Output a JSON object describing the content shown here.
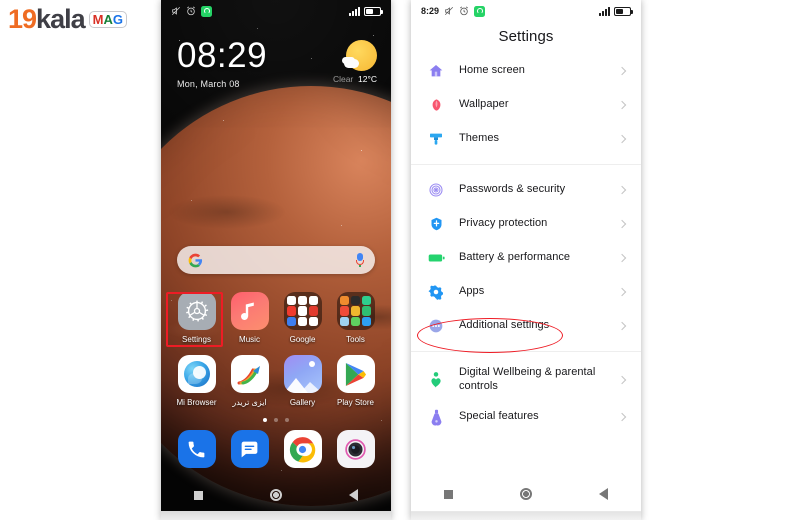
{
  "watermark": {
    "brand_prefix": "19",
    "brand_main": "kala",
    "badge": "MAG",
    "badge_letters": [
      "M",
      "A",
      "G"
    ],
    "color_orange": "#ef6c23",
    "color_dark": "#3f3f46"
  },
  "left_phone": {
    "status_bar": {
      "icons": [
        "mute-icon",
        "alarm-icon",
        "whatsapp-icon",
        "signal-icon",
        "battery-icon"
      ]
    },
    "clock_widget": {
      "time": "08:29",
      "date": "Mon, March 08"
    },
    "weather_widget": {
      "condition": "Clear",
      "temperature": "12°C",
      "icon": "sun-behind-cloud-icon"
    },
    "search_bar": {
      "logo": "G",
      "google_logo_letters": [
        "G"
      ],
      "mic": "microphone-icon",
      "placeholder": ""
    },
    "apps_row1": [
      {
        "label": "Settings",
        "icon": "gear-icon",
        "highlighted": true
      },
      {
        "label": "Music",
        "icon": "music-note-icon",
        "highlighted": false
      },
      {
        "label": "Google",
        "icon": "folder-icon",
        "highlighted": false
      },
      {
        "label": "Tools",
        "icon": "folder-icon",
        "highlighted": false
      }
    ],
    "apps_row2": [
      {
        "label": "Mi Browser",
        "icon": "mi-browser-icon"
      },
      {
        "label": "ایزی تریدر",
        "icon": "easy-trader-icon"
      },
      {
        "label": "Gallery",
        "icon": "gallery-icon"
      },
      {
        "label": "Play Store",
        "icon": "play-store-icon"
      }
    ],
    "dock": [
      {
        "label": "Phone",
        "icon": "phone-icon"
      },
      {
        "label": "Messages",
        "icon": "message-icon"
      },
      {
        "label": "Chrome",
        "icon": "chrome-icon"
      },
      {
        "label": "Camera",
        "icon": "camera-icon"
      }
    ],
    "page_dots": {
      "count": 3,
      "active_index": 0
    },
    "nav_bar": [
      "recents-square-icon",
      "home-circle-icon",
      "back-triangle-icon"
    ]
  },
  "right_phone": {
    "status_bar": {
      "time": "8:29",
      "icons": [
        "mute-icon",
        "alarm-icon",
        "whatsapp-icon",
        "signal-icon",
        "battery-icon"
      ]
    },
    "title": "Settings",
    "groups": [
      {
        "items": [
          {
            "label": "Home screen",
            "icon": "house-icon",
            "color": "#8b7ef0"
          },
          {
            "label": "Wallpaper",
            "icon": "flower-icon",
            "color": "#f8566f"
          },
          {
            "label": "Themes",
            "icon": "paint-brush-icon",
            "color": "#2ba7f0"
          }
        ]
      },
      {
        "items": [
          {
            "label": "Passwords & security",
            "icon": "fingerprint-icon",
            "color": "#9b8cf2"
          },
          {
            "label": "Privacy protection",
            "icon": "shield-icon",
            "color": "#2196f3"
          },
          {
            "label": "Battery & performance",
            "icon": "battery-icon",
            "color": "#24d36e"
          },
          {
            "label": "Apps",
            "icon": "gear-icon",
            "color": "#2196f3"
          },
          {
            "label": "Additional settings",
            "icon": "dots-circle-icon",
            "color": "#9aa6e8",
            "highlighted": true
          }
        ]
      },
      {
        "items": [
          {
            "label": "Digital Wellbeing & parental controls",
            "icon": "wellbeing-heart-icon",
            "color": "#23cc7a"
          },
          {
            "label": "Special features",
            "icon": "flask-icon",
            "color": "#8b7ef0"
          }
        ]
      }
    ],
    "chevron": "chevron-right-icon",
    "nav_bar": [
      "recents-square-icon",
      "home-circle-icon",
      "back-triangle-icon"
    ]
  },
  "annotations": {
    "left_highlight": {
      "shape": "rectangle",
      "target": "Settings",
      "color": "#ee1c25"
    },
    "right_highlight": {
      "shape": "ellipse",
      "target": "Additional settings",
      "color": "#ee1c25"
    }
  }
}
